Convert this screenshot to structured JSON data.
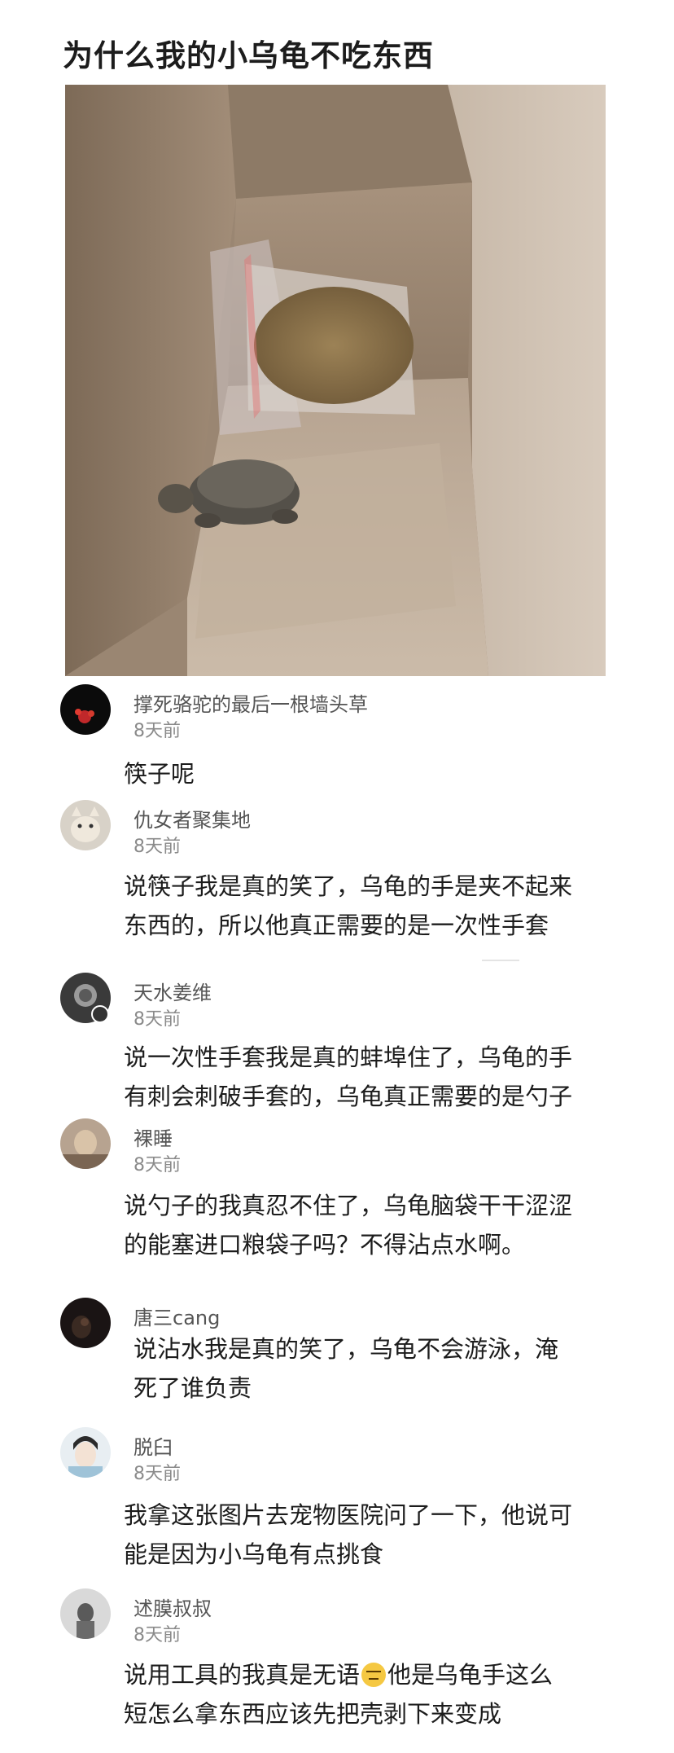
{
  "post": {
    "title": "为什么我的小乌龟不吃东西"
  },
  "comments": [
    {
      "username": "撑死骆驼的最后一根墙头草",
      "time": "8天前",
      "lines": [
        "筷子呢"
      ]
    },
    {
      "username": "仇女者聚集地",
      "time": "8天前",
      "lines": [
        "说筷子我是真的笑了，乌龟的手是夹不起来",
        "东西的，所以他真正需要的是一次性手套"
      ]
    },
    {
      "username": "天水姜维",
      "time": "8天前",
      "lines": [
        "说一次性手套我是真的蚌埠住了，乌龟的手",
        "有刺会刺破手套的，乌龟真正需要的是勺子"
      ]
    },
    {
      "username": "裸睡",
      "time": "8天前",
      "lines": [
        "说勺子的我真忍不住了，乌龟脑袋干干涩涩",
        "的能塞进口粮袋子吗？不得沾点水啊。"
      ]
    },
    {
      "username": "唐三cang",
      "lines": [
        "说沾水我是真的笑了，乌龟不会游泳，淹",
        "死了谁负责"
      ]
    },
    {
      "username": "脱臼",
      "time": "8天前",
      "lines": [
        "我拿这张图片去宠物医院问了一下，他说可",
        "能是因为小乌龟有点挑食"
      ]
    },
    {
      "username": "述膜叔叔",
      "time": "8天前",
      "line1_before": "说用工具的我真是无语",
      "line1_after": "他是乌龟手这么",
      "line2": "短怎么拿东西应该先把壳剥下来变成"
    }
  ],
  "icons": {
    "emoji": "expressionless-face-icon",
    "badge": "avatar-badge-icon"
  },
  "colors": {
    "username": "#555555",
    "time": "#8a8a8a",
    "text": "#1c1c1c"
  }
}
